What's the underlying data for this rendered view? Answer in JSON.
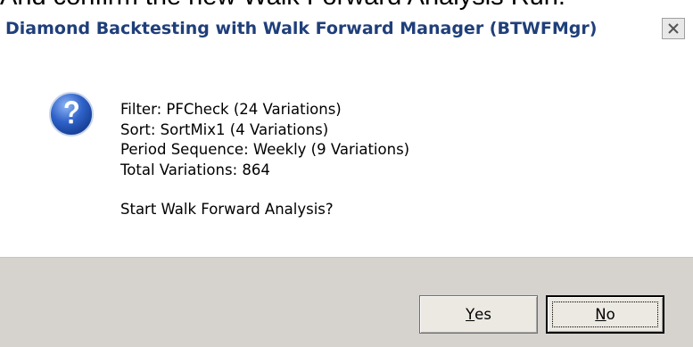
{
  "caption": "And confirm the new Walk Forward Analysis Run.",
  "dialog": {
    "title": "Diamond Backtesting with Walk Forward Manager (BTWFMgr)",
    "icon": "question-icon",
    "message_lines": [
      "Filter: PFCheck (24 Variations)",
      "Sort: SortMix1 (4 Variations)",
      "Period Sequence: Weekly (9 Variations)",
      "Total Variations: 864"
    ],
    "question": "Start Walk Forward Analysis?",
    "buttons": {
      "yes": {
        "accel": "Y",
        "rest": "es"
      },
      "no": {
        "accel": "N",
        "rest": "o"
      }
    }
  },
  "colors": {
    "title_text": "#1f3f7a",
    "footer_bg": "#d6d3ce",
    "icon_blue": "#2f62c9"
  }
}
